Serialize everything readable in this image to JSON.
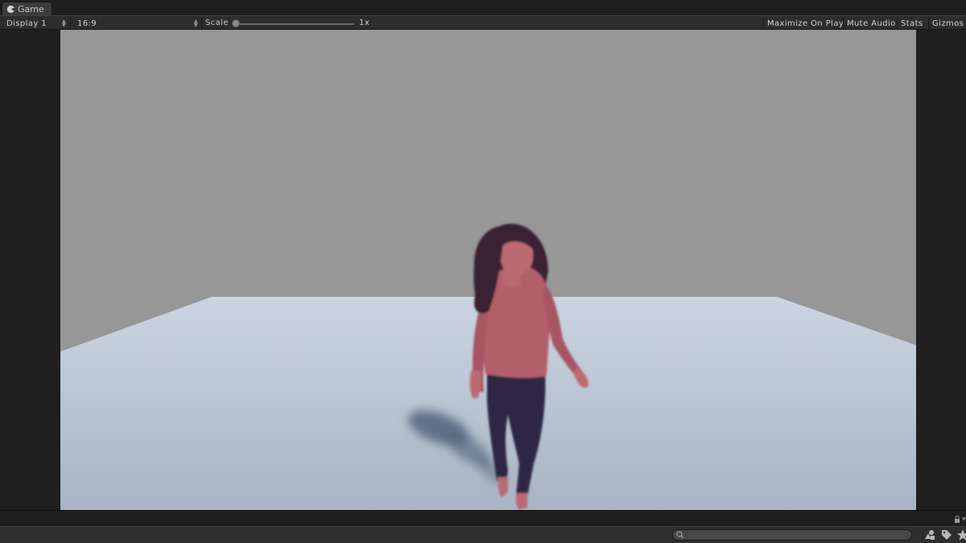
{
  "tab": {
    "title": "Game",
    "icon": "pacman-icon"
  },
  "toolbar": {
    "display": "Display 1",
    "aspect": "16:9",
    "scale_label": "Scale",
    "scale_value": "1x",
    "maximize_label": "Maximize On Play",
    "mute_label": "Mute Audio",
    "stats_label": "Stats",
    "gizmos_label": "Gizmos"
  },
  "bottom": {
    "search_icon": "search-icon",
    "icons": [
      "shapes-icon",
      "tag-icon",
      "star-icon",
      "lock-icon"
    ]
  },
  "colors": {
    "wall": "#979797",
    "floor_far": "#c8d3df",
    "floor_near": "#aeb9c8",
    "shirt": "#b35e6a",
    "leggings": "#2e2545",
    "hair": "#3a2030"
  }
}
